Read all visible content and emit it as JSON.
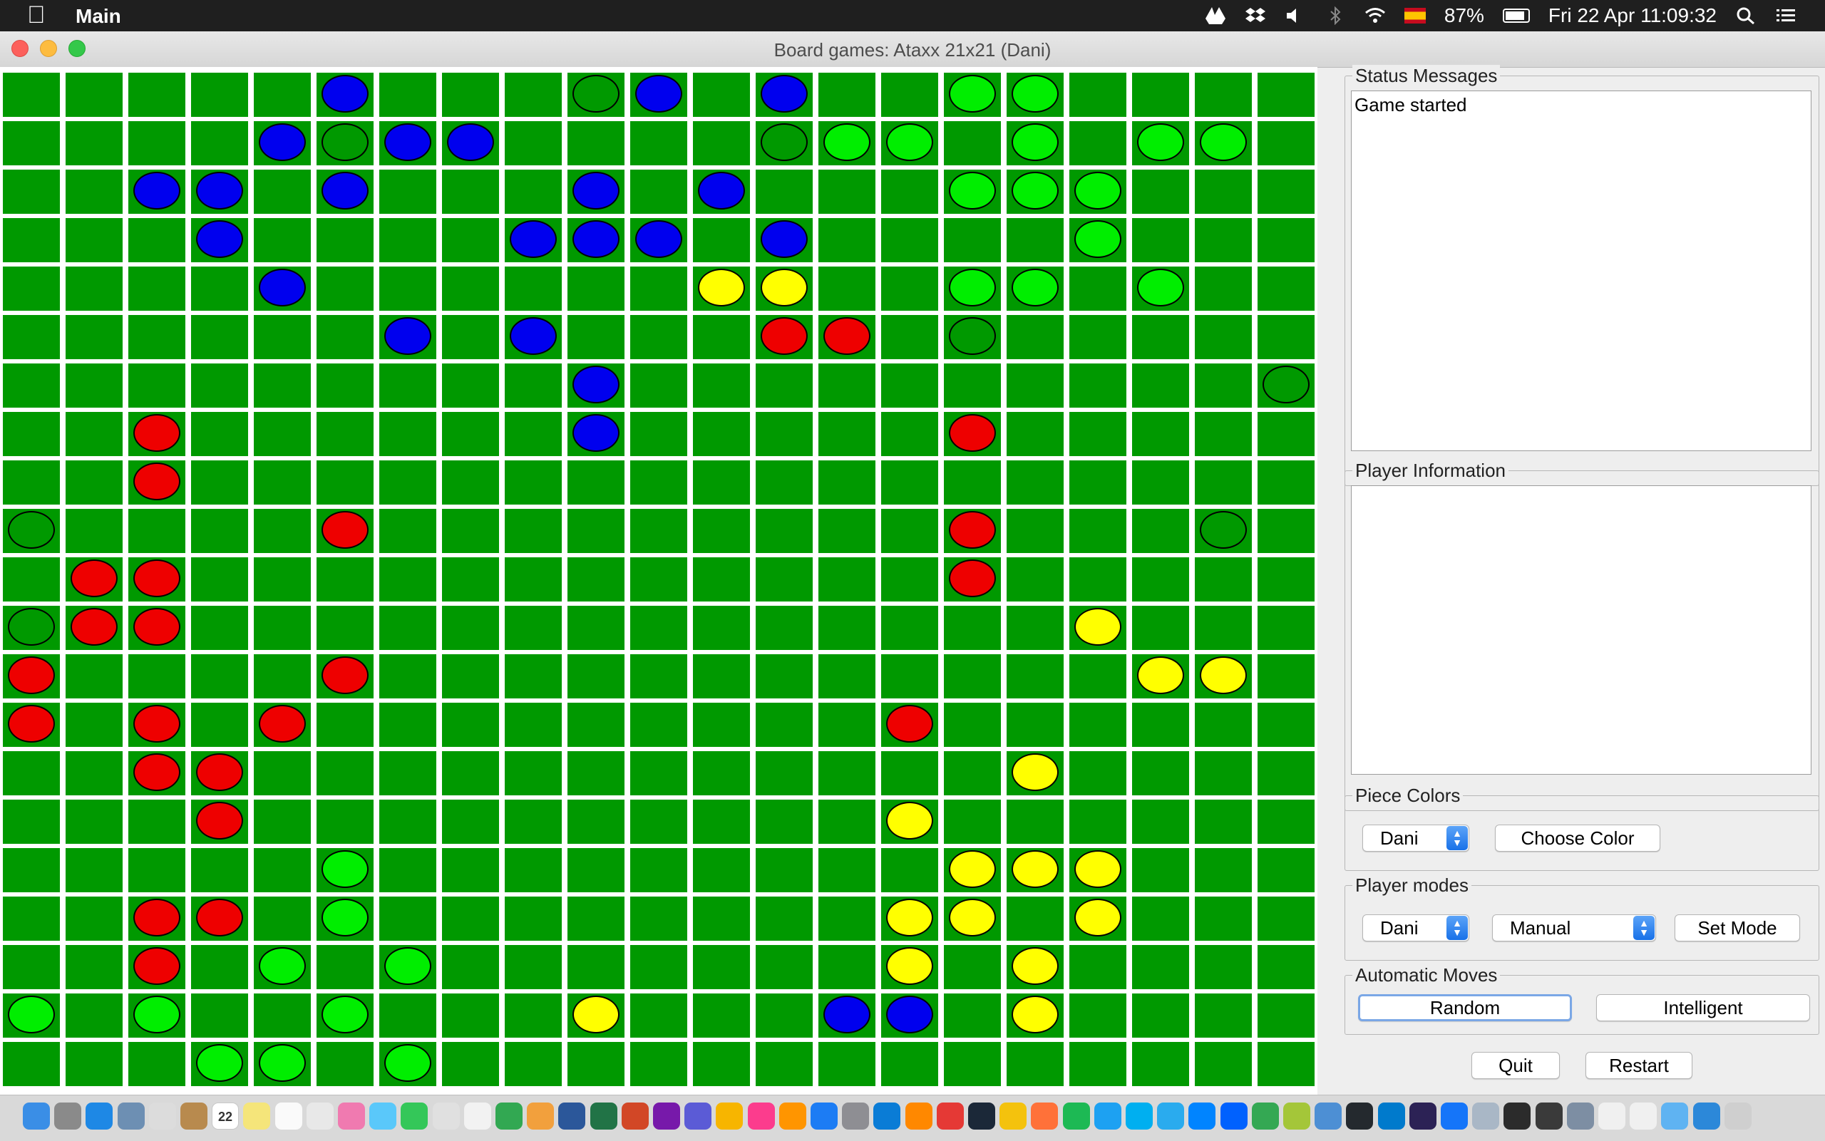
{
  "menubar": {
    "app_name": "Main",
    "battery": "87%",
    "datetime": "Fri 22 Apr  11:09:32",
    "icons": [
      "apple-icon",
      "drive-icon",
      "dropbox-icon",
      "volume-icon",
      "bluetooth-icon",
      "wifi-icon",
      "flag-es-icon",
      "battery-icon",
      "search-icon",
      "list-icon"
    ]
  },
  "window": {
    "title": "Board games: Ataxx 21x21 (Dani)"
  },
  "board": {
    "rows": 21,
    "cols": 21,
    "colors": {
      "cell": "#009900",
      "B": "#0000ee",
      "L": "#00ee00",
      "Y": "#ffff00",
      "R": "#ee0000",
      "O": "#009900"
    },
    "grid": [
      ".....B...OB.B..LL....",
      "....BOBB....OLL.L.LL.",
      "..BB.B...B.B...LLL...",
      "...B....BBB.B....L...",
      "....B......YY..LL.L..",
      "......B.B...RR.O.....",
      ".........B..........O",
      "..R......B.....R.....",
      "..R..................",
      "O....R.........R...O.",
      ".RR............R.....",
      "ORR..............Y...",
      "R....R............YY.",
      "R.R.R.........R......",
      "..RR............Y....",
      "...R..........Y......",
      ".....L.........YYY...",
      "..RR.L........YY.Y...",
      "..R.L.L.......Y.Y....",
      "L.L..L...Y...BB.Y....",
      "...LL.L.............."
    ]
  },
  "status": {
    "legend": "Status Messages",
    "text": "Game started"
  },
  "player_info": {
    "legend": "Player Information"
  },
  "piece_colors": {
    "legend": "Piece Colors",
    "player": "Dani",
    "choose_label": "Choose Color"
  },
  "player_modes": {
    "legend": "Player modes",
    "player": "Dani",
    "mode": "Manual",
    "set_label": "Set Mode"
  },
  "auto_moves": {
    "legend": "Automatic Moves",
    "random_label": "Random",
    "intelligent_label": "Intelligent"
  },
  "footer": {
    "quit_label": "Quit",
    "restart_label": "Restart"
  },
  "dock": {
    "calendar_day": "22",
    "icons": [
      {
        "name": "finder-icon",
        "color": "#3a8ee6"
      },
      {
        "name": "launchpad-icon",
        "color": "#8a8a8a"
      },
      {
        "name": "safari-icon",
        "color": "#1e88e5"
      },
      {
        "name": "preview-icon",
        "color": "#6d8fb3"
      },
      {
        "name": "rocket-icon",
        "color": "#dcdcdc"
      },
      {
        "name": "contacts-icon",
        "color": "#b88a4e"
      },
      {
        "name": "calendar-icon",
        "color": "#ffffff"
      },
      {
        "name": "notes-icon",
        "color": "#f5e57a"
      },
      {
        "name": "reminders-icon",
        "color": "#fafafa"
      },
      {
        "name": "textedit-icon",
        "color": "#e8e8e8"
      },
      {
        "name": "photos-icon",
        "color": "#f07ab0"
      },
      {
        "name": "messages-icon",
        "color": "#5ac8fa"
      },
      {
        "name": "facetime-icon",
        "color": "#34c759"
      },
      {
        "name": "script-icon",
        "color": "#e0e0e0"
      },
      {
        "name": "keynote-icon",
        "color": "#f2f2f2"
      },
      {
        "name": "numbers-icon",
        "color": "#32a852"
      },
      {
        "name": "pages-icon",
        "color": "#f2a03d"
      },
      {
        "name": "word-icon",
        "color": "#2b579a"
      },
      {
        "name": "excel-icon",
        "color": "#217346"
      },
      {
        "name": "powerpoint-icon",
        "color": "#d24726"
      },
      {
        "name": "onenote-icon",
        "color": "#7719aa"
      },
      {
        "name": "imovie-icon",
        "color": "#5b5bd6"
      },
      {
        "name": "sketch-icon",
        "color": "#f7b500"
      },
      {
        "name": "itunes-icon",
        "color": "#fc3c8d"
      },
      {
        "name": "books-icon",
        "color": "#ff9500"
      },
      {
        "name": "appstore-icon",
        "color": "#1c7cf4"
      },
      {
        "name": "settings-icon",
        "color": "#8e8e93"
      },
      {
        "name": "edge-icon",
        "color": "#0a7cd6"
      },
      {
        "name": "vlc-icon",
        "color": "#ff8800"
      },
      {
        "name": "popcorn-icon",
        "color": "#e53935"
      },
      {
        "name": "steam-icon",
        "color": "#1b2838"
      },
      {
        "name": "chrome-icon",
        "color": "#f4c20d"
      },
      {
        "name": "firefox-icon",
        "color": "#ff7139"
      },
      {
        "name": "spotify-icon",
        "color": "#1db954"
      },
      {
        "name": "twitter-icon",
        "color": "#1da1f2"
      },
      {
        "name": "skype-icon",
        "color": "#00aff0"
      },
      {
        "name": "telegram-icon",
        "color": "#2aabee"
      },
      {
        "name": "messenger-icon",
        "color": "#0084ff"
      },
      {
        "name": "dropbox-icon",
        "color": "#0061fe"
      },
      {
        "name": "drive-icon",
        "color": "#34a853"
      },
      {
        "name": "android-icon",
        "color": "#a4c639"
      },
      {
        "name": "virtualbox-icon",
        "color": "#4d8fd4"
      },
      {
        "name": "github-icon",
        "color": "#24292e"
      },
      {
        "name": "vscode-icon",
        "color": "#007acc"
      },
      {
        "name": "eclipse-icon",
        "color": "#2c2255"
      },
      {
        "name": "xcode-icon",
        "color": "#1575f9"
      },
      {
        "name": "box-icon",
        "color": "#a9b7c6"
      },
      {
        "name": "terminal-icon",
        "color": "#2b2b2b"
      },
      {
        "name": "activity-icon",
        "color": "#3a3a3a"
      },
      {
        "name": "scanner-icon",
        "color": "#7d8ea3"
      },
      {
        "name": "java-icon",
        "color": "#f0f0f0"
      },
      {
        "name": "java2-icon",
        "color": "#f0f0f0"
      },
      {
        "name": "folder-icon",
        "color": "#5fb3f2"
      },
      {
        "name": "vscode2-icon",
        "color": "#2c88d9"
      },
      {
        "name": "trash-icon",
        "color": "#cfcfcf"
      }
    ]
  }
}
